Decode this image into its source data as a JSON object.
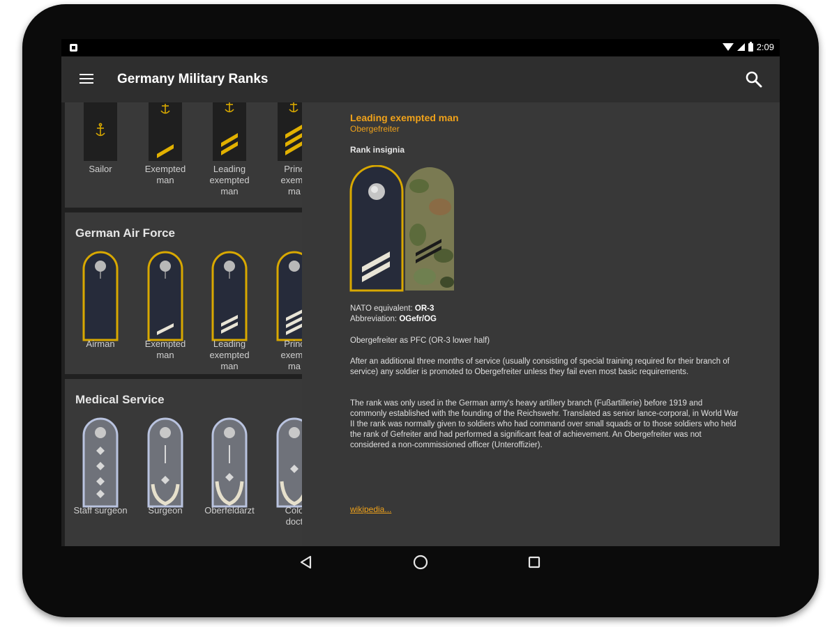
{
  "status_bar": {
    "time": "2:09"
  },
  "app_bar": {
    "title": "Germany Military Ranks"
  },
  "sections": [
    {
      "title": "",
      "ranks": [
        {
          "label": [
            "Sailor"
          ]
        },
        {
          "label": [
            "Exempted",
            "man"
          ]
        },
        {
          "label": [
            "Leading",
            "exempted",
            "man"
          ]
        },
        {
          "label": [
            "Princ",
            "exemp",
            "ma"
          ]
        }
      ]
    },
    {
      "title": "German Air Force",
      "ranks": [
        {
          "label": [
            "Airman"
          ]
        },
        {
          "label": [
            "Exempted",
            "man"
          ]
        },
        {
          "label": [
            "Leading",
            "exempted",
            "man"
          ]
        },
        {
          "label": [
            "Princ",
            "exemp",
            "ma"
          ]
        }
      ]
    },
    {
      "title": "Medical Service",
      "ranks": [
        {
          "label": [
            "Staff surgeon"
          ]
        },
        {
          "label": [
            "Surgeon"
          ]
        },
        {
          "label": [
            "Oberfeldarzt"
          ]
        },
        {
          "label": [
            "Colo",
            "doct"
          ]
        }
      ]
    }
  ],
  "detail": {
    "name": "Leading exempted man",
    "native_name": "Obergefreiter",
    "insignia_heading": "Rank insignia",
    "nato_label": "NATO equivalent: ",
    "nato_value": "OR-3",
    "abbr_label": "Abbreviation: ",
    "abbr_value": "OGefr/OG",
    "para1": "Obergefreiter as PFC (OR-3 lower half)",
    "para2": "After an additional three months of service (usually consisting of special training required for their branch of service) any soldier is promoted to Obergefreiter unless they fail even most basic requirements.",
    "para3": "The rank was only used in the German army's heavy artillery branch (Fußartillerie) before 1919 and commonly established with the founding of the Reichswehr. Translated as senior lance-corporal, in World War II the rank was normally given to soldiers who had command over small squads or to those soldiers who held the rank of Gefreiter and had performed a significant feat of achievement. An Obergefreiter was not considered a non-commissioned officer (Unteroffizier).",
    "link": "wikipedia..."
  },
  "colors": {
    "accent": "#f0a21a",
    "strap_navy": "#262b3a",
    "gold": "#e2b100"
  },
  "icons": {
    "menu": "menu-icon",
    "search": "search-icon",
    "back": "back-icon",
    "home": "home-icon",
    "recents": "recents-icon"
  }
}
